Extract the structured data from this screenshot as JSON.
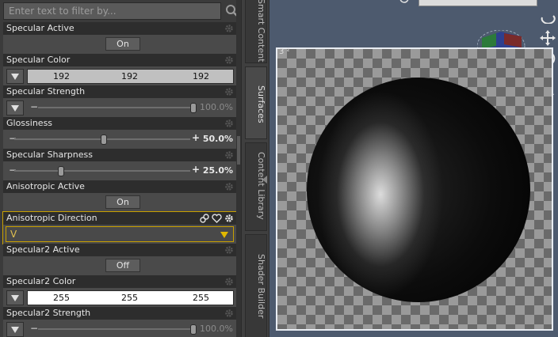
{
  "filter": {
    "placeholder": "Enter text to filter by..."
  },
  "properties": [
    {
      "title": "Specular Active",
      "type": "toggle",
      "value": "On"
    },
    {
      "title": "Specular Color",
      "type": "color",
      "rgb": [
        "192",
        "192",
        "192"
      ],
      "swatch": "#c0c0c0"
    },
    {
      "title": "Specular Strength",
      "type": "slider",
      "value": "100.0%",
      "fraction": 1.0,
      "dim": true
    },
    {
      "title": "Glossiness",
      "type": "slider",
      "value": "50.0%",
      "fraction": 0.5,
      "dim": false
    },
    {
      "title": "Specular Sharpness",
      "type": "slider",
      "value": "25.0%",
      "fraction": 0.25,
      "dim": false
    },
    {
      "title": "Anisotropic Active",
      "type": "toggle",
      "value": "On"
    },
    {
      "title": "Anisotropic Direction",
      "type": "select",
      "value": "V"
    },
    {
      "title": "Specular2 Active",
      "type": "toggle",
      "value": "Off"
    },
    {
      "title": "Specular2 Color",
      "type": "color",
      "rgb": [
        "255",
        "255",
        "255"
      ],
      "swatch": "#ffffff"
    },
    {
      "title": "Specular2 Strength",
      "type": "slider",
      "value": "100.0%",
      "fraction": 1.0,
      "dim": true
    }
  ],
  "tabs": [
    {
      "label": "Smart Content",
      "active": false
    },
    {
      "label": "Surfaces",
      "active": true
    },
    {
      "label": "Content Library",
      "active": false
    },
    {
      "label": "Shader Builder",
      "active": false
    }
  ],
  "viewport": {
    "frame_label": "3 ²",
    "accent": "#c8a000",
    "background": "#4d5a6e"
  },
  "icons": {
    "search": "magnifier-icon",
    "settings": "gear-icon",
    "link": "link-icon",
    "favorite": "heart-icon",
    "dropdown": "triangle-down-icon"
  }
}
